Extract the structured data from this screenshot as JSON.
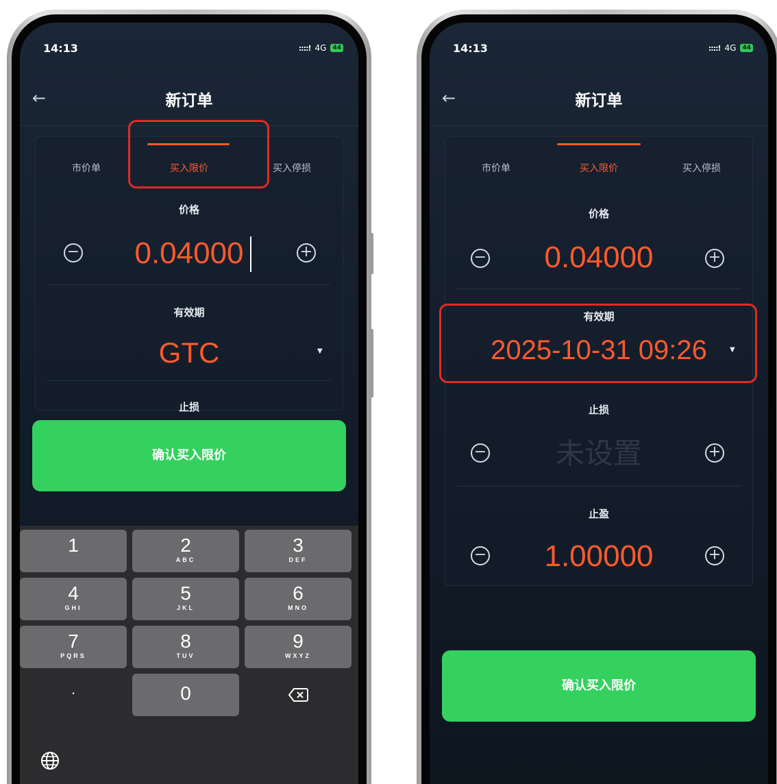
{
  "left_phone": {
    "status_time": "14:13",
    "network": "4G",
    "battery": "44",
    "nav_title": "新订单",
    "tabs": [
      "市价单",
      "买入限价",
      "买入停损"
    ],
    "active_tab": 1,
    "price_label": "价格",
    "price_value": "0.04000",
    "validity_label": "有效期",
    "validity_value": "GTC",
    "stop_loss_label": "止损",
    "confirm_label": "确认买入限价",
    "keyboard": {
      "keys": [
        {
          "num": "1",
          "letters": ""
        },
        {
          "num": "2",
          "letters": "ABC"
        },
        {
          "num": "3",
          "letters": "DEF"
        },
        {
          "num": "4",
          "letters": "GHI"
        },
        {
          "num": "5",
          "letters": "JKL"
        },
        {
          "num": "6",
          "letters": "MNO"
        },
        {
          "num": "7",
          "letters": "PQRS"
        },
        {
          "num": "8",
          "letters": "TUV"
        },
        {
          "num": "9",
          "letters": "WXYZ"
        },
        {
          "num": ".",
          "letters": ""
        },
        {
          "num": "0",
          "letters": ""
        }
      ]
    }
  },
  "right_phone": {
    "status_time": "14:13",
    "network": "4G",
    "battery": "44",
    "nav_title": "新订单",
    "tabs": [
      "市价单",
      "买入限价",
      "买入停损"
    ],
    "active_tab": 1,
    "price_label": "价格",
    "price_value": "0.04000",
    "validity_label": "有效期",
    "validity_value": "2025-10-31 09:26",
    "stop_loss_label": "止损",
    "stop_loss_value": "未设置",
    "take_profit_label": "止盈",
    "take_profit_value": "1.00000",
    "confirm_label": "确认买入限价"
  },
  "colors": {
    "accent": "#ff5a2c",
    "confirm": "#34d15f",
    "highlight_box": "#e02b25",
    "screen_bg": "#141e2c"
  },
  "icons": [
    "back-arrow-icon",
    "minus-circle-icon",
    "plus-circle-icon",
    "dropdown-triangle-icon",
    "backspace-icon",
    "globe-icon"
  ]
}
